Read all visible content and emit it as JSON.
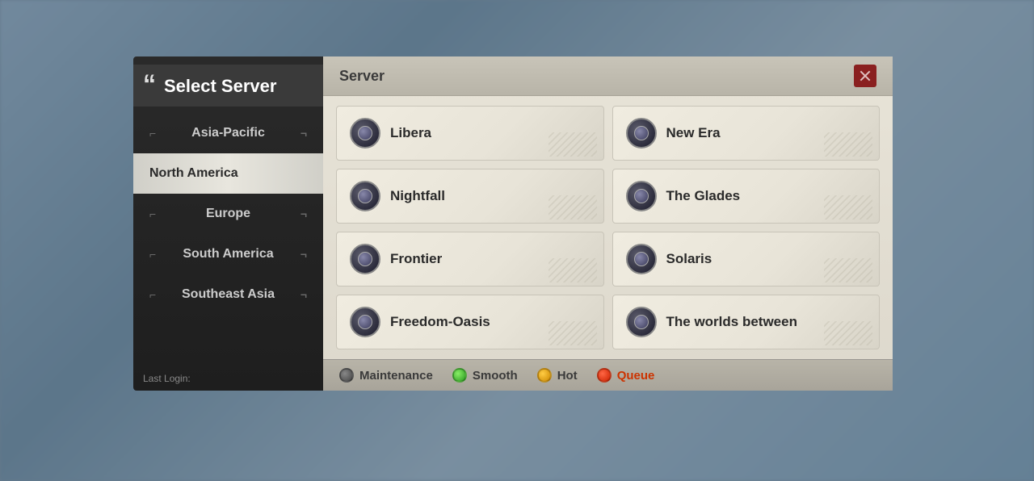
{
  "background": {
    "color": "#7a8fa0"
  },
  "leftPanel": {
    "title": "Select Server",
    "regions": [
      {
        "id": "asia-pacific",
        "label": "Asia-Pacific",
        "active": false
      },
      {
        "id": "north-america",
        "label": "North America",
        "active": true
      },
      {
        "id": "europe",
        "label": "Europe",
        "active": false
      },
      {
        "id": "south-america",
        "label": "South America",
        "active": false
      },
      {
        "id": "southeast-asia",
        "label": "Southeast Asia",
        "active": false
      }
    ],
    "lastLogin": "Last Login:"
  },
  "rightPanel": {
    "header": "Server",
    "closeButton": "✕",
    "servers": [
      {
        "id": "libera",
        "name": "Libera"
      },
      {
        "id": "new-era",
        "name": "New Era"
      },
      {
        "id": "nightfall",
        "name": "Nightfall"
      },
      {
        "id": "the-glades",
        "name": "The Glades"
      },
      {
        "id": "frontier",
        "name": "Frontier"
      },
      {
        "id": "solaris",
        "name": "Solaris"
      },
      {
        "id": "freedom-oasis",
        "name": "Freedom-Oasis"
      },
      {
        "id": "the-worlds-between",
        "name": "The worlds between"
      }
    ]
  },
  "statusBar": {
    "items": [
      {
        "id": "maintenance",
        "type": "maintenance",
        "label": "Maintenance"
      },
      {
        "id": "smooth",
        "type": "smooth",
        "label": "Smooth"
      },
      {
        "id": "hot",
        "type": "hot",
        "label": "Hot"
      },
      {
        "id": "queue",
        "type": "queue",
        "label": "Queue"
      }
    ]
  }
}
